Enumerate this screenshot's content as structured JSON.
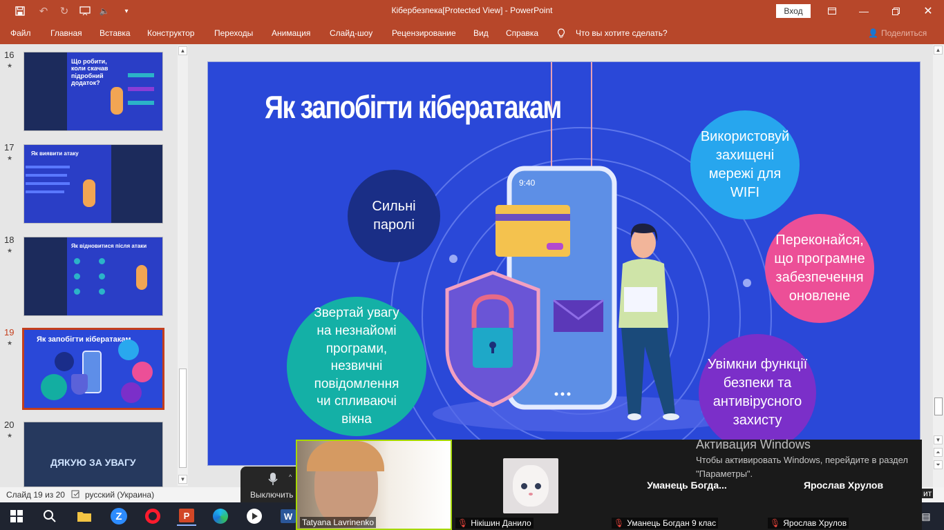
{
  "app": {
    "window_title": "Кібербезпека[Protected View]  -  PowerPoint",
    "sign_in": "Вход",
    "tell_me": "Что вы хотите сделать?",
    "share": "Поделиться"
  },
  "ribbon_tabs": [
    "Файл",
    "Главная",
    "Вставка",
    "Конструктор",
    "Переходы",
    "Анимация",
    "Слайд-шоу",
    "Рецензирование",
    "Вид",
    "Справка"
  ],
  "thumbnails": [
    {
      "num": "16",
      "star": "★",
      "title": "Що робити, коли скачав підробний додаток?"
    },
    {
      "num": "17",
      "star": "★",
      "title": "Як виявити атаку"
    },
    {
      "num": "18",
      "star": "★",
      "title": "Як відновитися після атаки"
    },
    {
      "num": "19",
      "star": "★",
      "title": "Як запобігти кібератакам"
    },
    {
      "num": "20",
      "star": "★",
      "title": "ДЯКУЮ ЗА УВАГУ"
    }
  ],
  "slide": {
    "title": "Як запобігти кібератакам",
    "phone_time": "9:40",
    "bubbles": {
      "passwords": "Сильні паролі",
      "wifi": "Використовуй захищені мережі для WIFI",
      "update": "Переконайся, що програмне забезпечення оновлене",
      "attention": "Звертай увагу на незнайомі програми, незвичні повідомлення чи спливаючі вікна",
      "security": "Увімкни функції безпеки та антивірусного захисту"
    }
  },
  "status": {
    "slide_info": "Слайд 19 из 20",
    "language": "русский (Украина)"
  },
  "zoom": {
    "mute_label": "Выключить",
    "participants": [
      {
        "name": "Tatyana Lavrinenko",
        "display": ""
      },
      {
        "name": "Нікішин Данило",
        "display": ""
      },
      {
        "name": "Уманець Богдан 9 клас",
        "display": "Уманець  Богда..."
      },
      {
        "name": "Ярослав Хрулов",
        "display": "Ярослав Хрулов"
      }
    ],
    "right_fragment": "ит"
  },
  "activation": {
    "title": "Активация Windows",
    "text": "Чтобы активировать Windows, перейдите в раздел \"Параметры\"."
  },
  "colors": {
    "accent": "#b7472a",
    "slide_bg": "#2a48d8",
    "selection": "#c43e1c"
  }
}
